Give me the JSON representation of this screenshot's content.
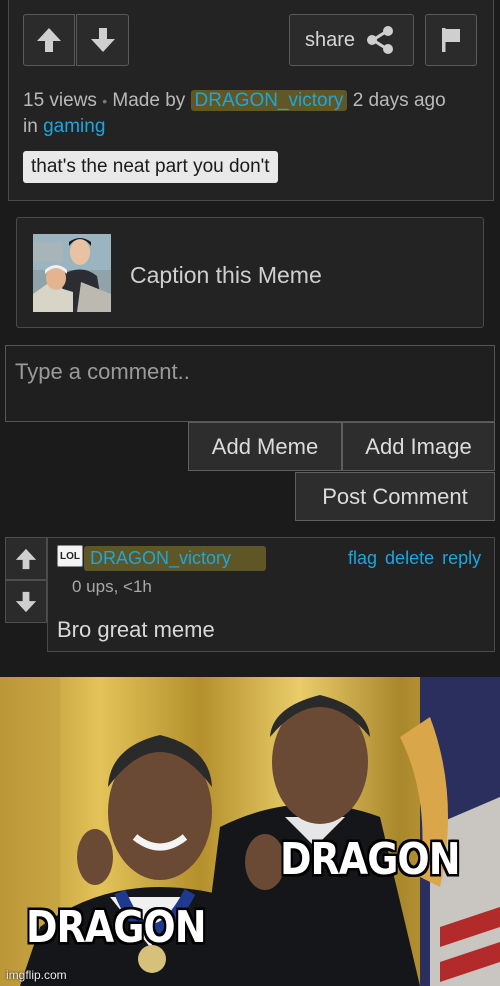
{
  "post": {
    "share_label": "share",
    "views": "15 views",
    "separator": "•",
    "made_by": "Made by",
    "username": "DRAGON_victory",
    "time": "2 days ago",
    "in_label": "in",
    "stream": "gaming",
    "tag": "that's the neat part you don't"
  },
  "caption": {
    "label": "Caption this Meme"
  },
  "comment_form": {
    "placeholder": "Type a comment..",
    "add_meme": "Add Meme",
    "add_image": "Add Image",
    "post_comment": "Post Comment"
  },
  "comment": {
    "badge": "LOL",
    "username": "DRAGON_victory",
    "flag": "flag",
    "delete": "delete",
    "reply": "reply",
    "stats": "0 ups, <1h",
    "text": "Bro great meme"
  },
  "meme": {
    "text_top": "DRAGON",
    "text_bottom": "DRAGON",
    "watermark": "imgflip.com"
  },
  "colors": {
    "background": "#1b1b1c",
    "link": "#1ba6e0",
    "highlight": "#aa9628"
  }
}
